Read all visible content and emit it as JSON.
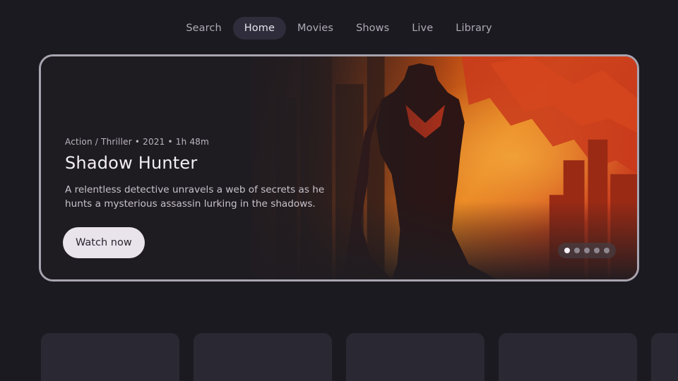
{
  "nav": {
    "items": [
      {
        "label": "Search",
        "active": false
      },
      {
        "label": "Home",
        "active": true
      },
      {
        "label": "Movies",
        "active": false
      },
      {
        "label": "Shows",
        "active": false
      },
      {
        "label": "Live",
        "active": false
      },
      {
        "label": "Library",
        "active": false
      }
    ]
  },
  "hero": {
    "meta": "Action / Thriller • 2021 • 1h 48m",
    "title": "Shadow Hunter",
    "description": "A relentless detective unravels a web of secrets as he hunts a mysterious assassin lurking in the shadows.",
    "cta_label": "Watch now",
    "pager": {
      "count": 5,
      "active_index": 0
    }
  },
  "colors": {
    "background": "#1b1a20",
    "nav_active": "#2f2d3b",
    "hero_border": "#a8a4b0",
    "cta_bg": "#e9e3ec",
    "art_orange": "#e0641e",
    "art_red": "#c2361a"
  },
  "row": {
    "card_count": 5
  }
}
